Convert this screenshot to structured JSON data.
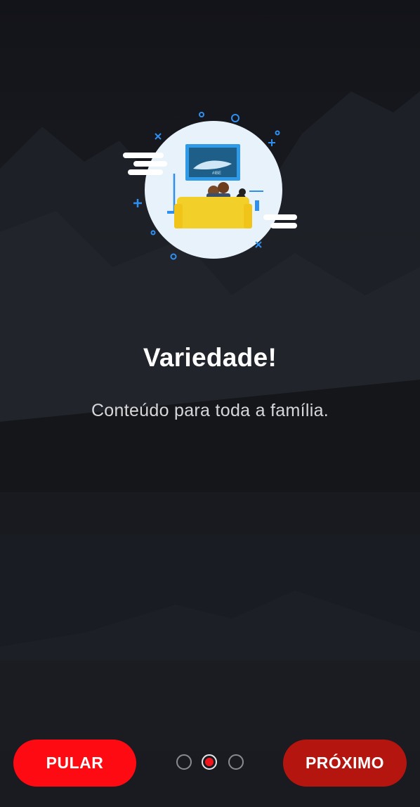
{
  "onboarding": {
    "title": "Variedade!",
    "subtitle": "Conteúdo para toda a família.",
    "illustration_icon": "family-watching-tv-illustration",
    "tv_screen_text": "#IBE",
    "current_page": 2,
    "total_pages": 3
  },
  "actions": {
    "skip_label": "PULAR",
    "next_label": "PRÓXIMO"
  },
  "colors": {
    "skip_button": "#fe0a12",
    "next_button": "#b5150f",
    "active_dot": "#f0141c",
    "illustration_accent": "#2f8ff0",
    "sofa": "#f3cf2a"
  }
}
